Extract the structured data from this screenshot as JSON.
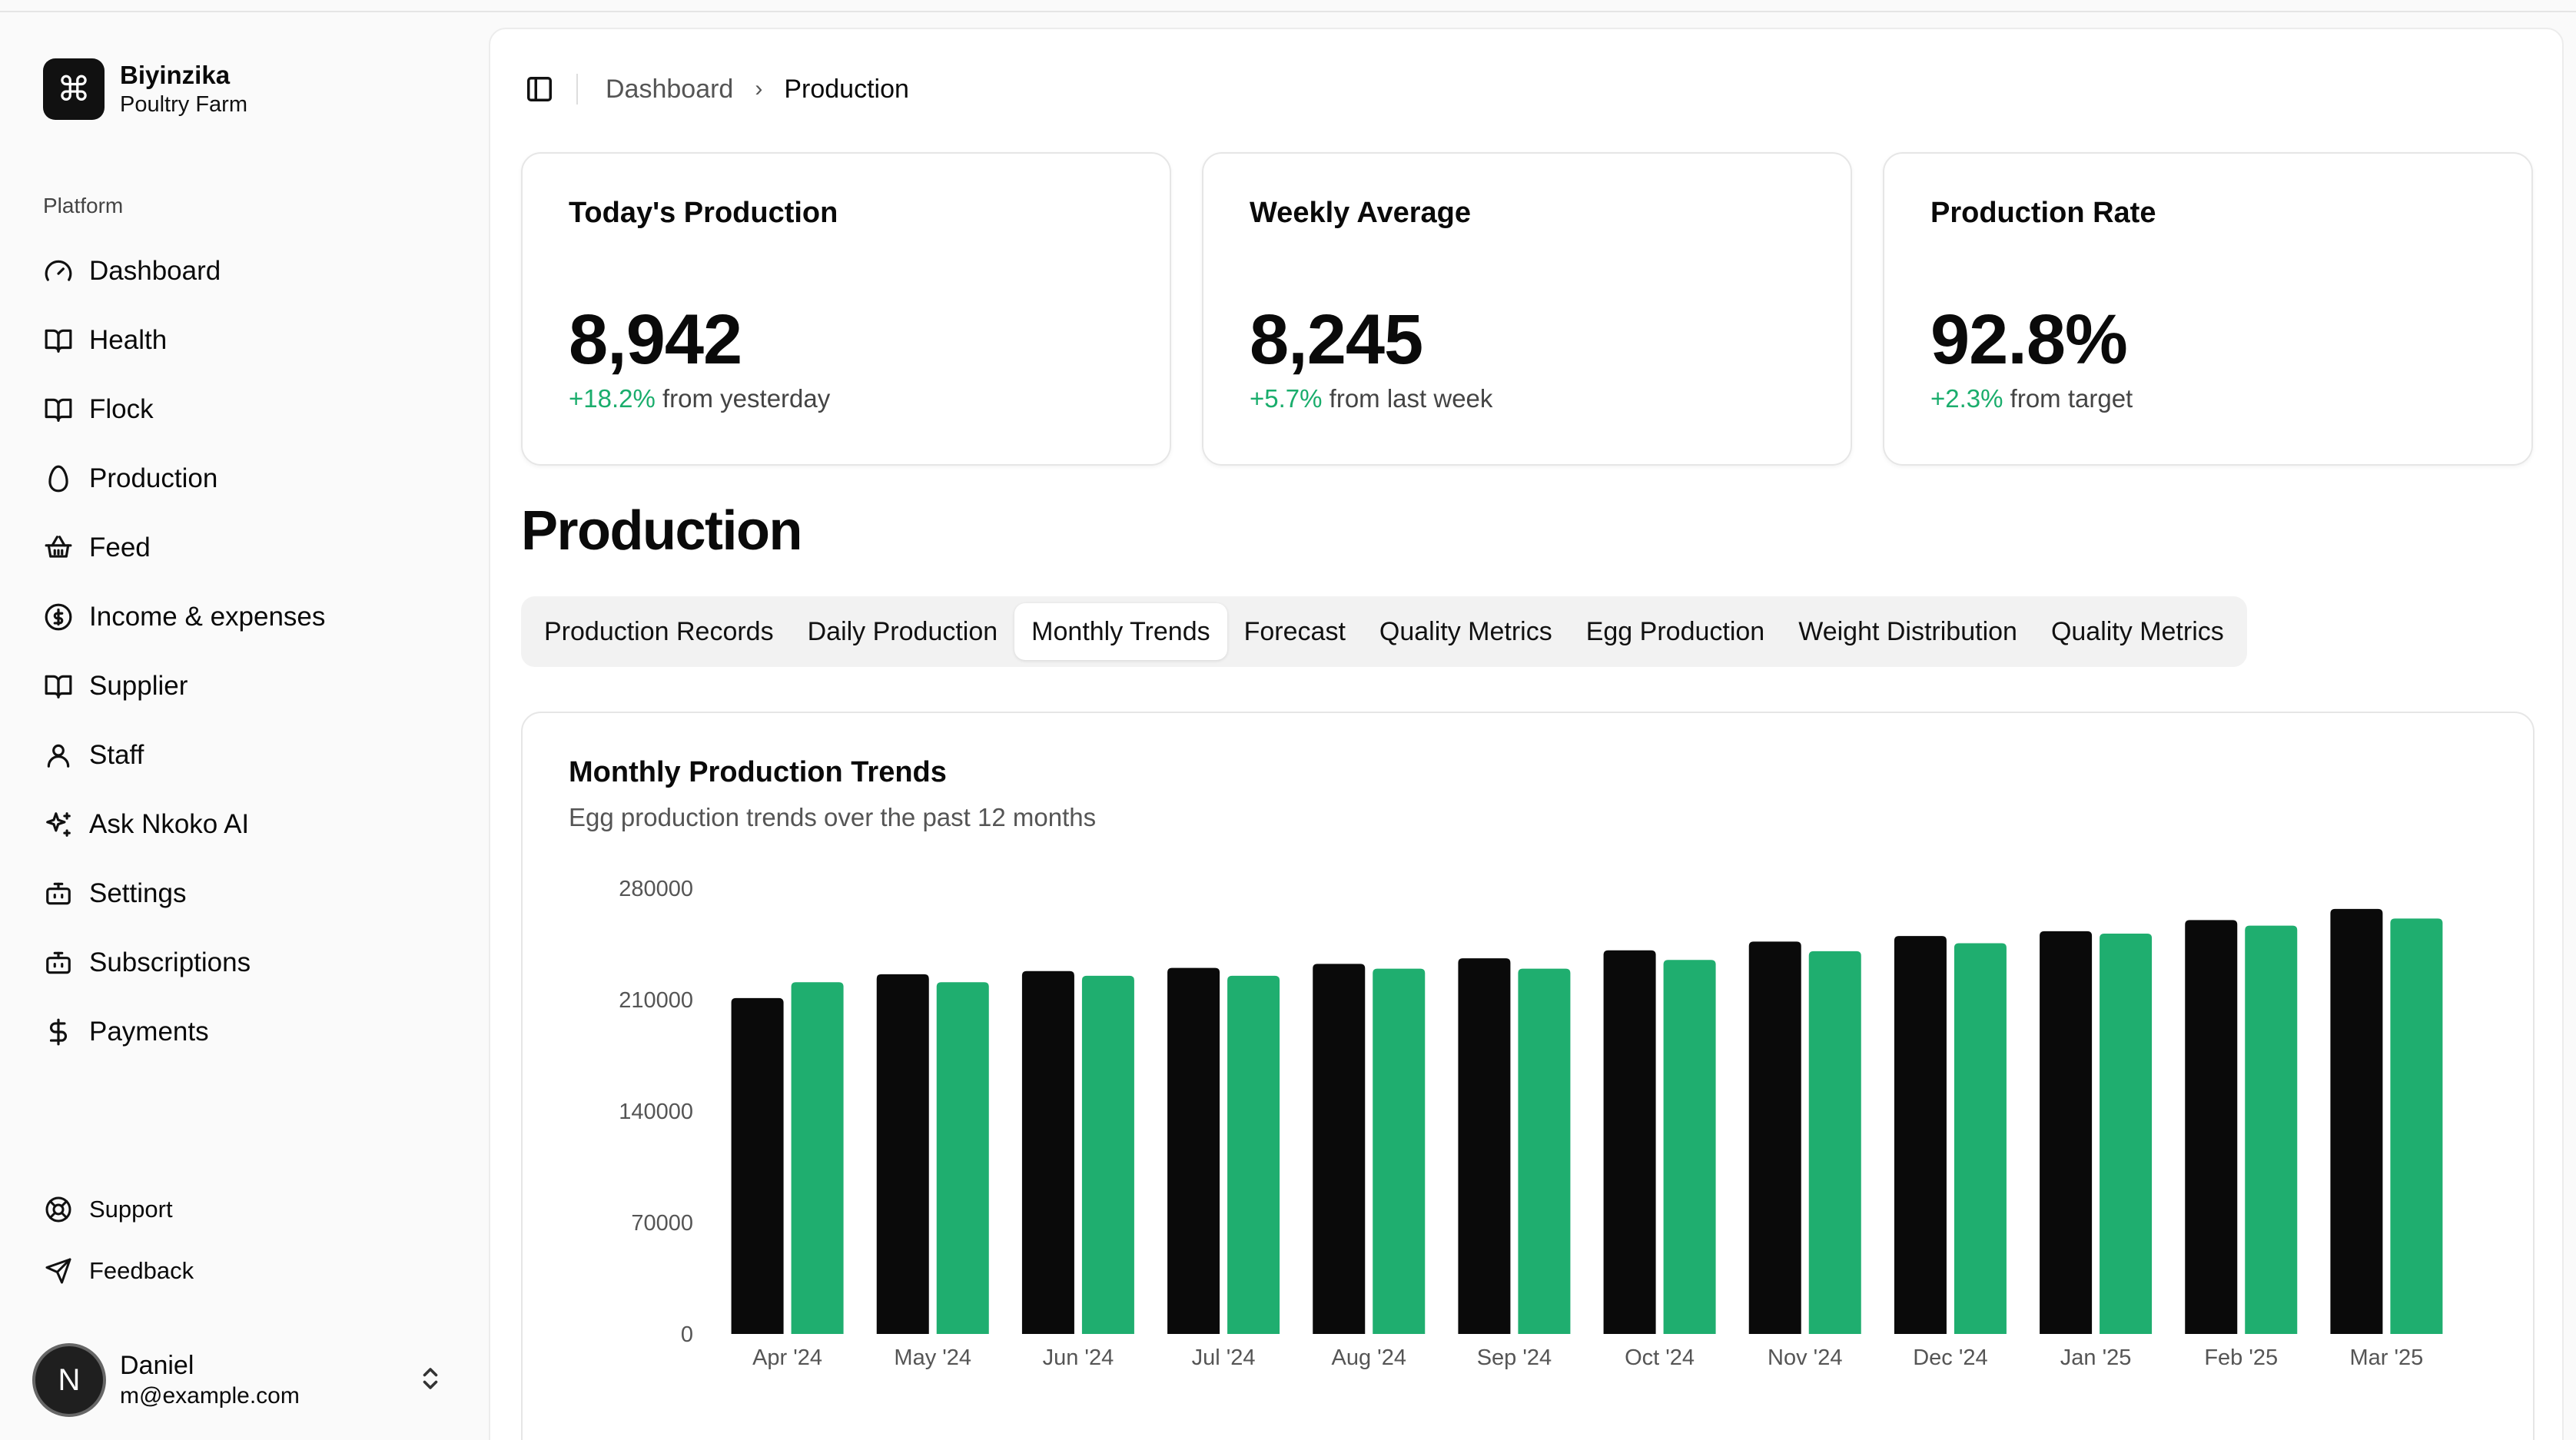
{
  "brand": {
    "logo_glyph": "⌘",
    "name": "Biyinzika",
    "subtitle": "Poultry Farm"
  },
  "sidebar": {
    "group_label": "Platform",
    "items": [
      {
        "label": "Dashboard",
        "icon": "gauge-icon"
      },
      {
        "label": "Health",
        "icon": "book-open-icon"
      },
      {
        "label": "Flock",
        "icon": "book-open-icon"
      },
      {
        "label": "Production",
        "icon": "egg-icon"
      },
      {
        "label": "Feed",
        "icon": "basket-icon"
      },
      {
        "label": "Income & expenses",
        "icon": "dollar-circle-icon"
      },
      {
        "label": "Supplier",
        "icon": "book-open-icon"
      },
      {
        "label": "Staff",
        "icon": "user-icon"
      },
      {
        "label": "Ask Nkoko AI",
        "icon": "sparkles-icon"
      },
      {
        "label": "Settings",
        "icon": "bot-icon"
      },
      {
        "label": "Subscriptions",
        "icon": "bot-icon"
      },
      {
        "label": "Payments",
        "icon": "dollar-icon"
      }
    ],
    "footer": [
      {
        "label": "Support",
        "icon": "life-buoy-icon"
      },
      {
        "label": "Feedback",
        "icon": "send-icon"
      }
    ],
    "user": {
      "initial": "N",
      "name": "Daniel",
      "email": "m@example.com"
    }
  },
  "breadcrumb": {
    "parent": "Dashboard",
    "separator": "›",
    "current": "Production"
  },
  "stats": [
    {
      "title": "Today's Production",
      "value": "8,942",
      "delta": "+18.2%",
      "delta_text": "from yesterday"
    },
    {
      "title": "Weekly Average",
      "value": "8,245",
      "delta": "+5.7%",
      "delta_text": "from last week"
    },
    {
      "title": "Production Rate",
      "value": "92.8%",
      "delta": "+2.3%",
      "delta_text": "from target"
    }
  ],
  "section_title": "Production",
  "tabs": [
    {
      "label": "Production Records",
      "active": false
    },
    {
      "label": "Daily Production",
      "active": false
    },
    {
      "label": "Monthly Trends",
      "active": true
    },
    {
      "label": "Forecast",
      "active": false
    },
    {
      "label": "Quality Metrics",
      "active": false
    },
    {
      "label": "Egg Production",
      "active": false
    },
    {
      "label": "Weight Distribution",
      "active": false
    },
    {
      "label": "Quality Metrics",
      "active": false
    }
  ],
  "chart_card": {
    "title": "Monthly Production Trends",
    "subtitle": "Egg production trends over the past 12 months"
  },
  "colors": {
    "accent_green": "#1fae6f",
    "bar_dark": "#0a0a0a",
    "delta_green": "#1aad6c"
  },
  "chart_data": {
    "type": "bar",
    "categories": [
      "Apr '24",
      "May '24",
      "Jun '24",
      "Jul '24",
      "Aug '24",
      "Sep '24",
      "Oct '24",
      "Nov '24",
      "Dec '24",
      "Jan '25",
      "Feb '25",
      "Mar '25"
    ],
    "series": [
      {
        "color": "#0a0a0a",
        "values": [
          211000,
          226000,
          228000,
          230000,
          232500,
          236000,
          241000,
          246500,
          250000,
          253000,
          260000,
          267000
        ]
      },
      {
        "color": "#1fae6f",
        "values": [
          221000,
          221000,
          225000,
          225000,
          229500,
          229500,
          235000,
          240500,
          245500,
          251500,
          256500,
          261000
        ]
      }
    ],
    "yticks": [
      0,
      70000,
      140000,
      210000,
      280000
    ],
    "ylim": [
      0,
      280000
    ],
    "grid": false,
    "legend": "none"
  }
}
